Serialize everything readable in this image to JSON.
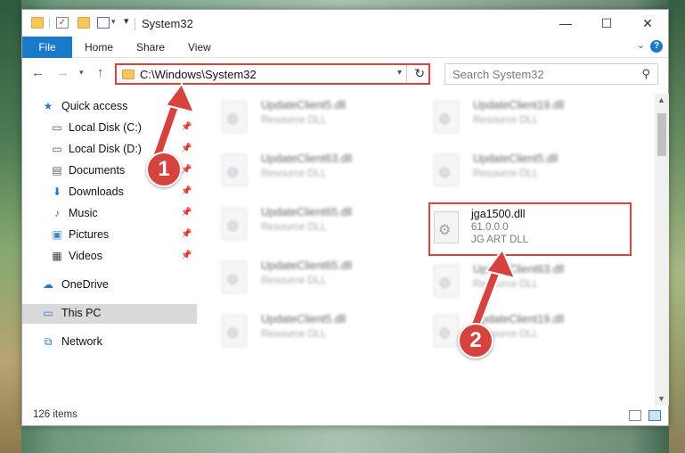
{
  "window": {
    "title": "System32",
    "minimize_icon": "minimize-icon",
    "maximize_icon": "maximize-icon",
    "close_icon": "close-icon"
  },
  "ribbon": {
    "tabs": [
      {
        "label": "File"
      },
      {
        "label": "Home"
      },
      {
        "label": "Share"
      },
      {
        "label": "View"
      }
    ]
  },
  "nav": {
    "address": "C:\\Windows\\System32",
    "search_placeholder": "Search System32"
  },
  "sidebar": {
    "items": [
      {
        "label": "Quick access",
        "icon": "star-icon"
      },
      {
        "label": "Local Disk (C:)",
        "icon": "drive-icon"
      },
      {
        "label": "Local Disk (D:)",
        "icon": "drive-icon"
      },
      {
        "label": "Documents",
        "icon": "documents-icon"
      },
      {
        "label": "Downloads",
        "icon": "download-icon"
      },
      {
        "label": "Music",
        "icon": "music-icon"
      },
      {
        "label": "Pictures",
        "icon": "pictures-icon"
      },
      {
        "label": "Videos",
        "icon": "videos-icon"
      },
      {
        "label": "OneDrive",
        "icon": "cloud-icon"
      },
      {
        "label": "This PC",
        "icon": "computer-icon"
      },
      {
        "label": "Network",
        "icon": "network-icon"
      }
    ]
  },
  "files": {
    "left": [
      {
        "name": "UpdateClient5.dll",
        "type": "Resource DLL"
      },
      {
        "name": "UpdateClient63.dll",
        "type": "Resource DLL"
      },
      {
        "name": "UpdateClient65.dll",
        "type": "Resource DLL"
      },
      {
        "name": "UpdateClient65.dll",
        "type": "Resource DLL"
      },
      {
        "name": "UpdateClient5.dll",
        "type": "Resource DLL"
      }
    ],
    "right": [
      {
        "name": "UpdateClient19.dll",
        "type": "Resource DLL"
      },
      {
        "name": "UpdateClient5.dll",
        "type": "Resource DLL"
      },
      {
        "name": "UpdateClient63.dll",
        "type": "Resource DLL"
      },
      {
        "name": "UpdateClient19.dll",
        "type": "Resource DLL"
      }
    ],
    "highlighted": {
      "name": "jga1500.dll",
      "version": "61.0.0.0",
      "description": "JG ART DLL"
    }
  },
  "status": {
    "item_count": "126 items"
  },
  "annotations": {
    "step1": "1",
    "step2": "2",
    "color": "#d6433f"
  }
}
